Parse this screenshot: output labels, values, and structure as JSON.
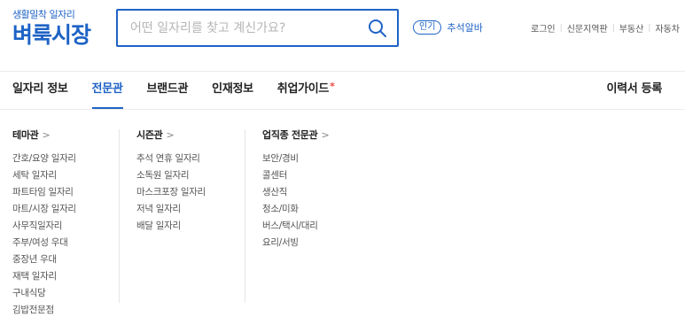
{
  "logo": {
    "subtitle": "생활밀착 일자리",
    "title": "벼룩시장"
  },
  "search": {
    "placeholder": "어떤 일자리를 찾고 계신가요?",
    "value": "",
    "icon": "search-icon"
  },
  "popular": {
    "badge": "인기",
    "keyword": "추석알바"
  },
  "util_links": [
    "로그인",
    "신문지역판",
    "부동산",
    "자동차"
  ],
  "nav": {
    "items": [
      {
        "label": "일자리 정보",
        "active": false
      },
      {
        "label": "전문관",
        "active": true
      },
      {
        "label": "브랜드관",
        "active": false
      },
      {
        "label": "인재정보",
        "active": false
      },
      {
        "label": "취업가이드",
        "active": false,
        "star": "*"
      }
    ],
    "resume": "이력서 등록"
  },
  "dropdown": {
    "columns": [
      {
        "title": "테마관",
        "chevron": ">",
        "items": [
          "간호/요양 일자리",
          "세탁 일자리",
          "파트타임 일자리",
          "마트/시장 일자리",
          "사무직일자리",
          "주부/여성 우대",
          "중장년 우대",
          "재택 일자리",
          "구내식당",
          "김밥전문점"
        ]
      },
      {
        "title": "시즌관",
        "chevron": ">",
        "items": [
          "추석 연휴 일자리",
          "소독원 일자리",
          "마스크포장 일자리",
          "저녁 일자리",
          "배달 일자리"
        ]
      },
      {
        "title": "업직종 전문관",
        "chevron": ">",
        "items": [
          "보안/경비",
          "콜센터",
          "생산직",
          "청소/미화",
          "버스/택시/대리",
          "요리/서빙"
        ]
      }
    ]
  },
  "colors": {
    "brand": "#1e63c6",
    "accent_star": "#e8453c"
  }
}
